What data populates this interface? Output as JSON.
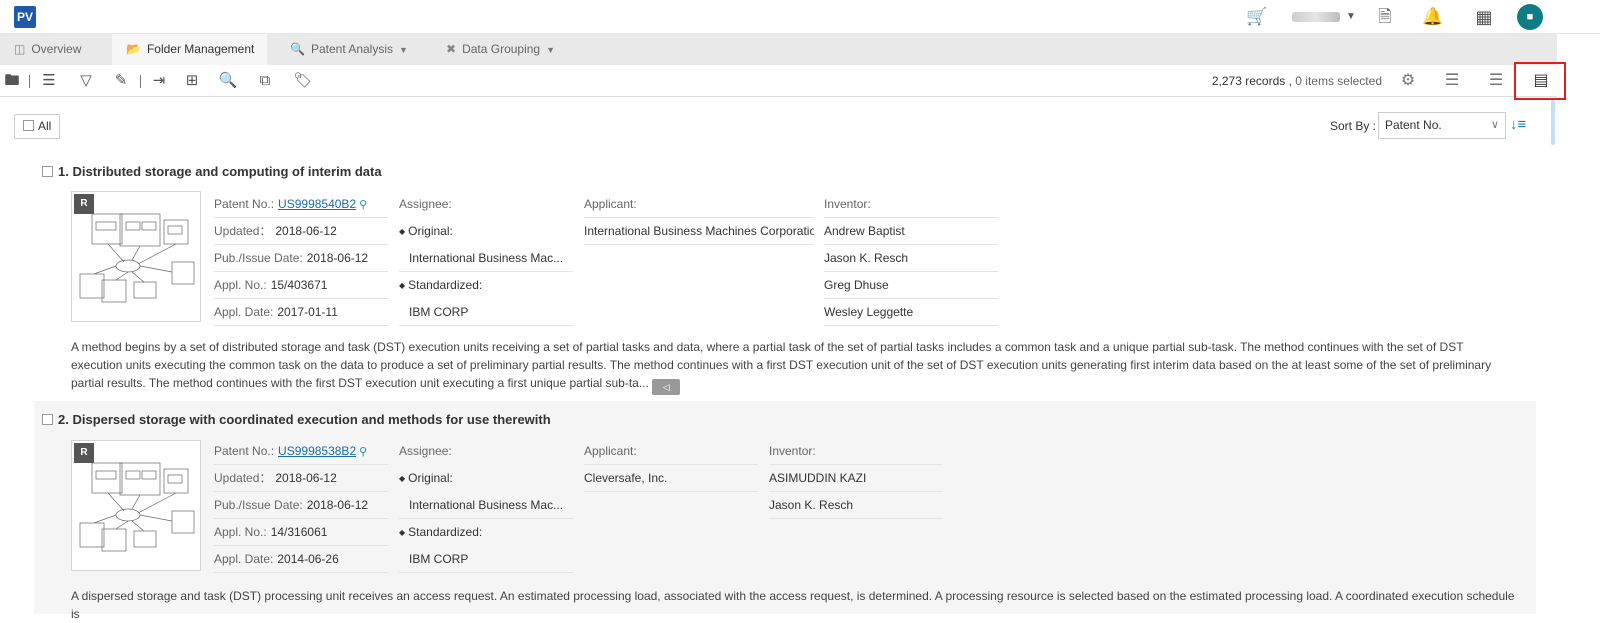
{
  "app": {
    "logo": "PV"
  },
  "header_icons": [
    "cart-icon",
    "user-menu",
    "export-icon",
    "bell-icon",
    "apps-grid-icon",
    "avatar"
  ],
  "tabs": [
    {
      "label": "Overview",
      "icon": "building-icon"
    },
    {
      "label": "Folder Management",
      "icon": "folder-icon",
      "active": true
    },
    {
      "label": "Patent Analysis",
      "icon": "search-analysis-icon",
      "dropdown": true
    },
    {
      "label": "Data Grouping",
      "icon": "grouping-icon",
      "dropdown": true
    }
  ],
  "toolbar": {
    "records": "2,273 records",
    "separator": " , ",
    "selected": "0 items selected"
  },
  "list": {
    "all_label": "All",
    "sort_label": "Sort By :",
    "sort_value": "Patent No."
  },
  "labels": {
    "patent_no": "Patent No.:",
    "updated": "Updated：",
    "pub_date": "Pub./Issue Date:",
    "appl_no": "Appl. No.:",
    "appl_date": "Appl. Date:",
    "assignee": "Assignee:",
    "original": "Original:",
    "standardized": "Standardized:",
    "applicant": "Applicant:",
    "inventor": "Inventor:"
  },
  "results": [
    {
      "index": "1.",
      "title": "Distributed storage and computing of interim data",
      "badge": "R",
      "patent_no": "US9998540B2",
      "updated": "2018-06-12",
      "pub_date": "2018-06-12",
      "appl_no": "15/403671",
      "appl_date": "2017-01-11",
      "original": "International Business Mac...",
      "standardized": "IBM CORP",
      "applicant": "International Business Machines Corporation",
      "inventors": [
        "Andrew Baptist",
        "Jason K. Resch",
        "Greg Dhuse",
        "Wesley Leggette"
      ],
      "abstract": "A method begins by a set of distributed storage and task (DST) execution units receiving a set of partial tasks and data, where a partial task of the set of partial tasks includes a common task and a unique partial sub-task. The method continues with the set of DST execution units executing the common task on the data to produce a set of preliminary partial results. The method continues with a first DST execution unit of the set of DST execution units generating first interim data based on the at least some of the set of preliminary partial results. The method continues with the first DST execution unit executing a first unique partial sub-ta..."
    },
    {
      "index": "2.",
      "title": "Dispersed storage with coordinated execution and methods for use therewith",
      "badge": "R",
      "patent_no": "US9998538B2",
      "updated": "2018-06-12",
      "pub_date": "2018-06-12",
      "appl_no": "14/316061",
      "appl_date": "2014-06-26",
      "original": "International Business Mac...",
      "standardized": "IBM CORP",
      "applicant": "Cleversafe, Inc.",
      "inventors": [
        "ASIMUDDIN KAZI",
        "Jason K. Resch"
      ],
      "abstract": "A dispersed storage and task (DST) processing unit receives an access request. An estimated processing load, associated with the access request, is determined. A processing resource is selected based on the estimated processing load. A coordinated execution schedule is"
    }
  ]
}
